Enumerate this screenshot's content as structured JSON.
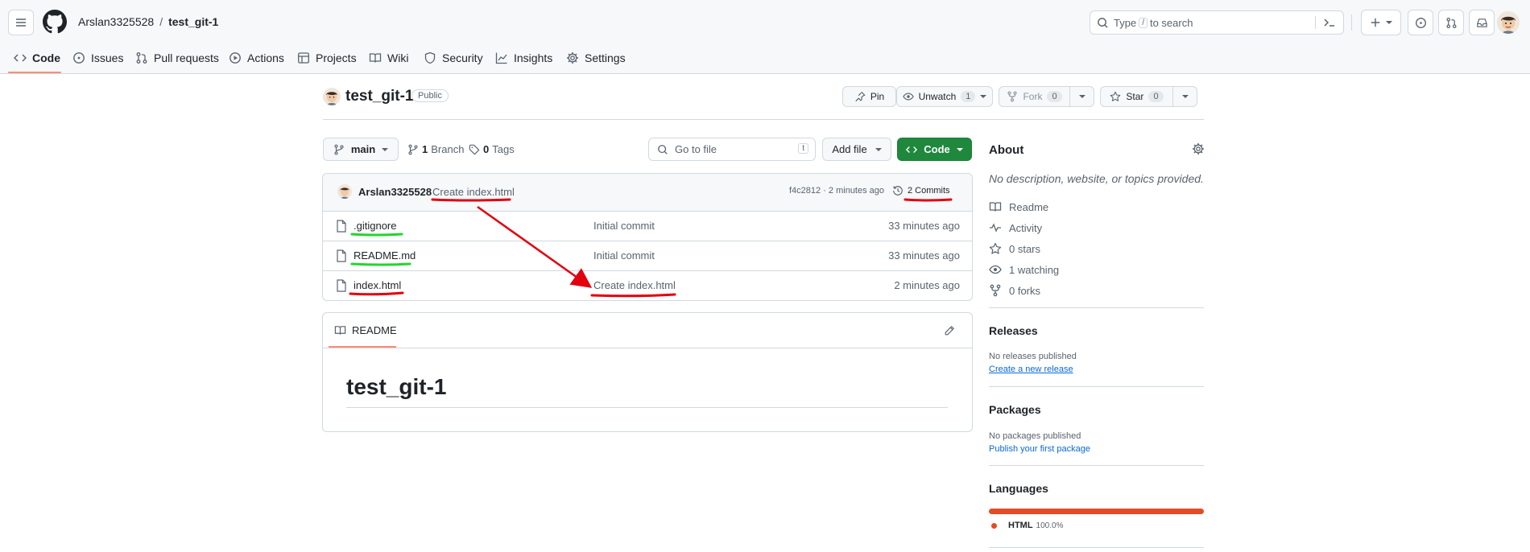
{
  "header": {
    "owner": "Arslan3325528",
    "slash": "/",
    "repo": "test_git-1",
    "search_prefix": "Type",
    "search_key": "/",
    "search_suffix": "to search"
  },
  "tabs": [
    {
      "label": "Code",
      "icon": "code-icon",
      "active": true
    },
    {
      "label": "Issues",
      "icon": "issue-icon"
    },
    {
      "label": "Pull requests",
      "icon": "pull-request-icon"
    },
    {
      "label": "Actions",
      "icon": "play-icon"
    },
    {
      "label": "Projects",
      "icon": "table-icon"
    },
    {
      "label": "Wiki",
      "icon": "book-icon"
    },
    {
      "label": "Security",
      "icon": "shield-icon"
    },
    {
      "label": "Insights",
      "icon": "graph-icon"
    },
    {
      "label": "Settings",
      "icon": "gear-icon"
    }
  ],
  "repo": {
    "title": "test_git-1",
    "visibility": "Public",
    "pin": "Pin",
    "watch": "Unwatch",
    "watch_count": "1",
    "fork": "Fork",
    "fork_count": "0",
    "star": "Star",
    "star_count": "0"
  },
  "toolbar": {
    "branch": "main",
    "branches_num": "1",
    "branches_label": "Branch",
    "tags_num": "0",
    "tags_label": "Tags",
    "go_to_file": "Go to file",
    "go_to_file_key": "t",
    "add_file": "Add file",
    "code": "Code"
  },
  "commit": {
    "author": "Arslan3325528",
    "message": "Create index.html",
    "meta": "f4c2812 · 2 minutes ago",
    "commits": "2 Commits"
  },
  "files": [
    {
      "name": ".gitignore",
      "message": "Initial commit",
      "time": "33 minutes ago"
    },
    {
      "name": "README.md",
      "message": "Initial commit",
      "time": "33 minutes ago"
    },
    {
      "name": "index.html",
      "message": "Create index.html",
      "time": "2 minutes ago"
    }
  ],
  "readme": {
    "tab": "README",
    "heading": "test_git-1"
  },
  "about": {
    "title": "About",
    "description": "No description, website, or topics provided.",
    "readme": "Readme",
    "activity": "Activity",
    "stars": "0 stars",
    "watching": "1 watching",
    "forks": "0 forks"
  },
  "releases": {
    "title": "Releases",
    "none": "No releases published",
    "link": "Create a new release"
  },
  "packages": {
    "title": "Packages",
    "none": "No packages published",
    "link": "Publish your first package"
  },
  "languages": {
    "title": "Languages",
    "name": "HTML",
    "percent": "100.0%",
    "percent_value": 100,
    "color": "#e34c26"
  },
  "annotations": {
    "red": "#e3000f",
    "green": "#22d62e"
  }
}
